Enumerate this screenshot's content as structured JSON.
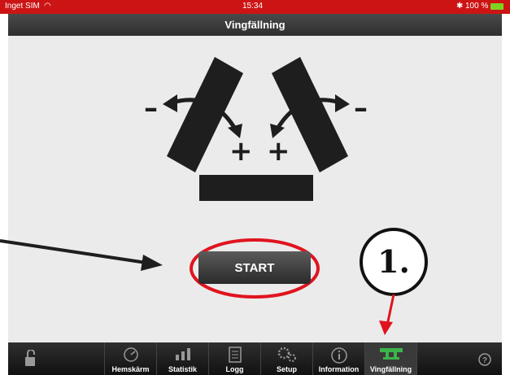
{
  "status_bar": {
    "carrier": "Inget SIM",
    "time": "15:34",
    "battery": "100 %"
  },
  "nav": {
    "title": "Vingfällning"
  },
  "diagram": {
    "minus_left": "–",
    "minus_right": "–",
    "plus_left": "+",
    "plus_right": "+"
  },
  "start_button": {
    "label": "START"
  },
  "annotation": {
    "step": "1."
  },
  "tabs": [
    {
      "label": "",
      "icon": "unlock-icon"
    },
    {
      "label": "Hemskärm",
      "icon": "speedometer-icon"
    },
    {
      "label": "Statistik",
      "icon": "bar-chart-icon"
    },
    {
      "label": "Logg",
      "icon": "document-icon"
    },
    {
      "label": "Setup",
      "icon": "gears-icon"
    },
    {
      "label": "Information",
      "icon": "info-icon"
    },
    {
      "label": "Vingfällning",
      "icon": "wing-fold-icon"
    },
    {
      "label": "",
      "icon": "help-icon"
    }
  ],
  "colors": {
    "status_bar": "#cc1414",
    "annotation_red": "#e0141e",
    "active_tab_green": "#3cb44a",
    "nav_bar": "#3a3a3a"
  }
}
